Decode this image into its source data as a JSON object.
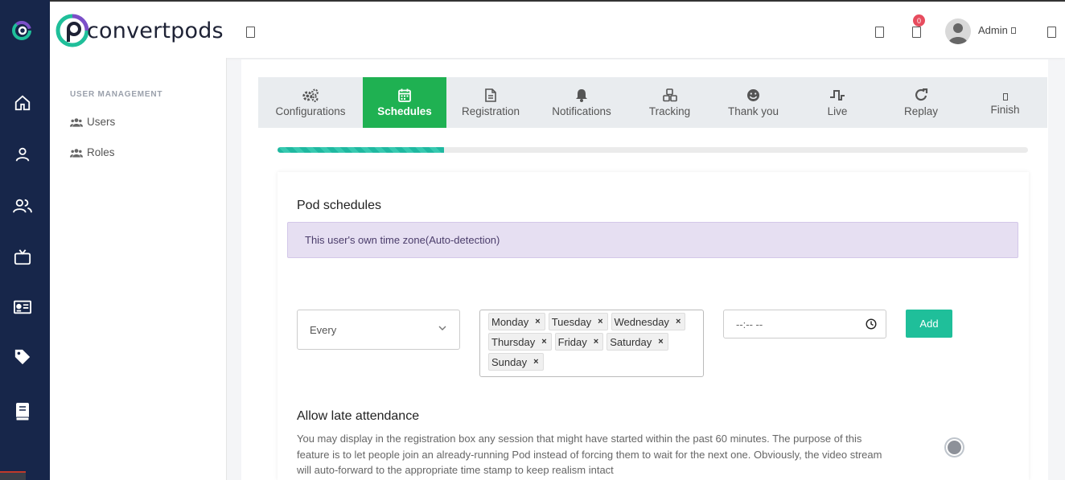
{
  "brand": {
    "name": "convertpods"
  },
  "header": {
    "notification_count": "0",
    "user_name": "Admin"
  },
  "rail": {
    "items": [
      "home-icon",
      "user-icon",
      "users-icon",
      "tv-icon",
      "id-card-icon",
      "tag-icon",
      "book-icon"
    ]
  },
  "sidebar": {
    "section_title": "USER MANAGEMENT",
    "items": [
      {
        "label": "Users",
        "icon": "users-icon"
      },
      {
        "label": "Roles",
        "icon": "users-icon"
      }
    ]
  },
  "tabs": [
    {
      "label": "Configurations",
      "icon": "cogs-icon",
      "active": false
    },
    {
      "label": "Schedules",
      "icon": "calendar-icon",
      "active": true
    },
    {
      "label": "Registration",
      "icon": "file-icon",
      "active": false
    },
    {
      "label": "Notifications",
      "icon": "bell-icon",
      "active": false
    },
    {
      "label": "Tracking",
      "icon": "cubes-icon",
      "active": false
    },
    {
      "label": "Thank you",
      "icon": "smile-icon",
      "active": false
    },
    {
      "label": "Live",
      "icon": "pulse-icon",
      "active": false
    },
    {
      "label": "Replay",
      "icon": "redo-icon",
      "active": false
    },
    {
      "label": "Finish",
      "icon": "flag-icon",
      "active": false
    }
  ],
  "progress": {
    "fraction": 0.222
  },
  "schedules": {
    "title": "Pod schedules",
    "timezone_notice": "This user's own time zone(Auto-detection)",
    "frequency": {
      "value": "Every"
    },
    "days": [
      "Monday",
      "Tuesday",
      "Wednesday",
      "Thursday",
      "Friday",
      "Saturday",
      "Sunday"
    ],
    "time": {
      "value": "--:-- --"
    },
    "add_label": "Add"
  },
  "late_attendance": {
    "title": "Allow late attendance",
    "description": "You may display in the registration box any session that might have started within the past 60 minutes. The purpose of this feature is to let people join an already-running Pod instead of forcing them to wait for the next one. Obviously, the video stream will auto-forward to the appropriate time stamp to keep realism intact",
    "enabled": false
  },
  "colors": {
    "rail": "#17264a",
    "active_tab": "#1fb152",
    "accent": "#1fbf9a",
    "badge": "#e74c5e",
    "notice_bg": "#e6dff2"
  }
}
